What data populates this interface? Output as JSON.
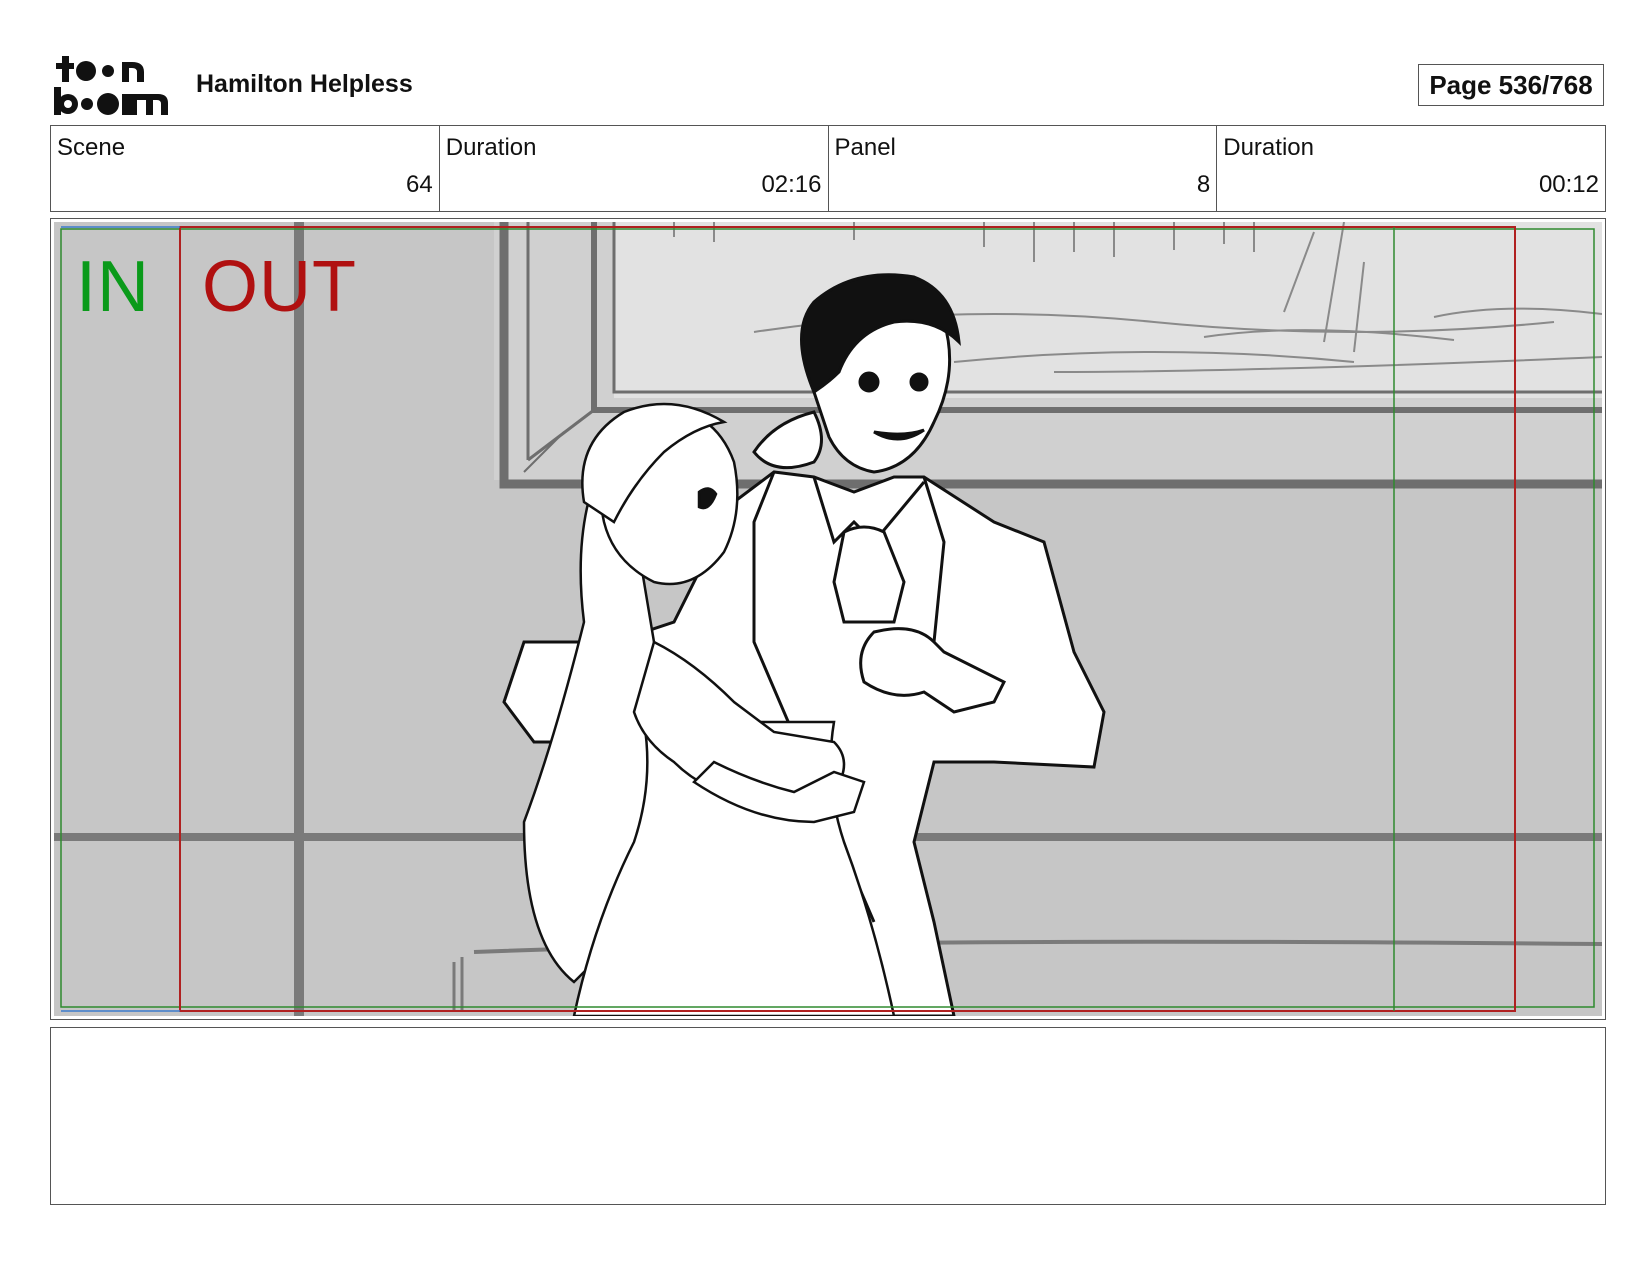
{
  "header": {
    "logo_text": "toon boom",
    "project_title": "Hamilton Helpless",
    "page_label": "Page 536/768"
  },
  "info": {
    "scene_label": "Scene",
    "scene_value": "64",
    "scene_duration_label": "Duration",
    "scene_duration_value": "02:16",
    "panel_label": "Panel",
    "panel_value": "8",
    "panel_duration_label": "Duration",
    "panel_duration_value": "00:12"
  },
  "frame": {
    "in_label": "IN",
    "out_label": "OUT",
    "in_color": "#0a9a1a",
    "out_color": "#b01010"
  },
  "notes": {
    "text": ""
  }
}
